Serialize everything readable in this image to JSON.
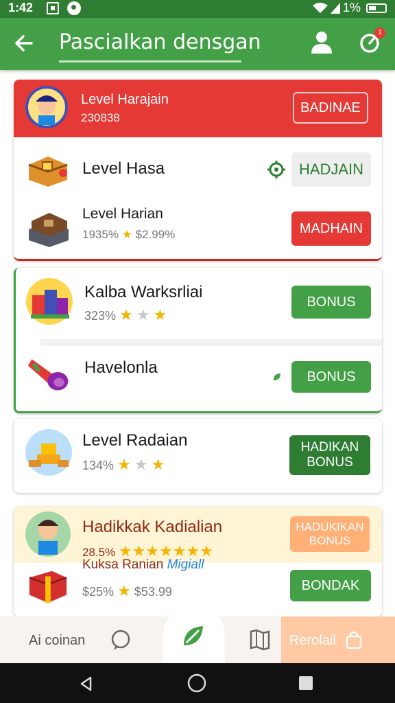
{
  "status_bar": {
    "time": "1:42",
    "battery_text": "1%"
  },
  "app_bar": {
    "title": "Pascialkan densgan",
    "notification_badge": "1"
  },
  "items": [
    {
      "name": "Level Harajain",
      "meta": "230838",
      "button": "BADINAE"
    },
    {
      "name": "Level Hasa",
      "button": "HADJAIN"
    },
    {
      "name": "Level Harian",
      "meta": "1935%",
      "price": "$2.99%",
      "stars_filled": 1,
      "stars_total": 1,
      "button": "MADHAIN"
    },
    {
      "name": "Kalba Warksrliai",
      "meta": "323%",
      "stars_filled": 2,
      "stars_total": 3,
      "button": "BONUS"
    },
    {
      "name": "Havelonla",
      "button": "BONUS"
    },
    {
      "name": "Level Radaian",
      "meta": "134%",
      "stars_filled": 2,
      "stars_total": 3,
      "button": "HADIKAN BONUS"
    },
    {
      "name": "Hadikkak Kadialian",
      "meta": "28.5%",
      "stars_filled": 7,
      "stars_total": 7,
      "button": "HADUKIKAN BONUS"
    },
    {
      "name": "Kuksa Ranian",
      "tag": "Migiall",
      "meta": "$25%",
      "price": "$53.99",
      "stars_filled": 1,
      "stars_total": 1,
      "button": "BONDAK"
    }
  ],
  "bottom_nav": {
    "left_label": "Ai coinan",
    "right_label": "Rerolail"
  },
  "colors": {
    "primary": "#43a047",
    "primary_dark": "#2e7d32",
    "danger": "#e53935",
    "star": "#f5b400",
    "highlight": "#fff5d6",
    "orange": "#ffb077"
  },
  "icons": [
    "back-arrow-icon",
    "profile-icon",
    "notification-icon",
    "chat-icon",
    "leaf-icon",
    "map-icon",
    "bag-icon"
  ]
}
